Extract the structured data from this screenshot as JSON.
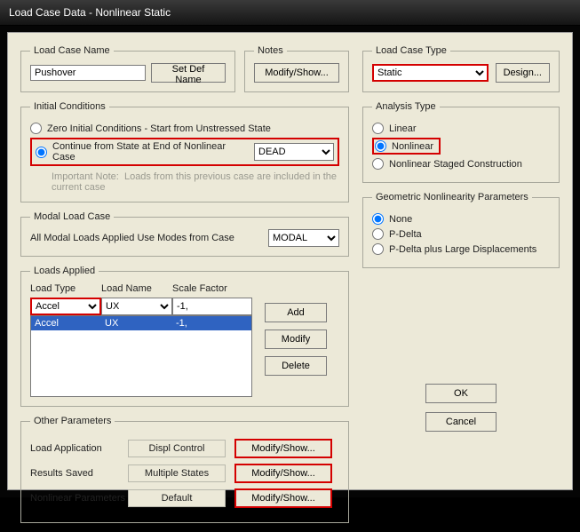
{
  "window": {
    "title": "Load Case Data - Nonlinear Static"
  },
  "loadCaseName": {
    "legend": "Load Case Name",
    "value": "Pushover",
    "setDefNameBtn": "Set Def Name"
  },
  "notes": {
    "legend": "Notes",
    "modifyShowBtn": "Modify/Show..."
  },
  "loadCaseType": {
    "legend": "Load Case Type",
    "selected": "Static",
    "designBtn": "Design..."
  },
  "initialConditions": {
    "legend": "Initial Conditions",
    "zeroLabel": "Zero Initial Conditions - Start from Unstressed State",
    "continueLabel": "Continue from State at End of Nonlinear Case",
    "continueCase": "DEAD",
    "noteLabel": "Important Note:",
    "noteText": "Loads from this previous case are included in the current case"
  },
  "analysisType": {
    "legend": "Analysis Type",
    "linearLabel": "Linear",
    "nonlinearLabel": "Nonlinear",
    "stagedLabel": "Nonlinear Staged Construction"
  },
  "modalLoadCase": {
    "legend": "Modal Load Case",
    "label": "All Modal Loads Applied Use Modes from Case",
    "selected": "MODAL"
  },
  "geometricNonlinearity": {
    "legend": "Geometric Nonlinearity Parameters",
    "noneLabel": "None",
    "pDeltaLabel": "P-Delta",
    "pDeltaLargeLabel": "P-Delta plus Large Displacements"
  },
  "loadsApplied": {
    "legend": "Loads Applied",
    "headers": {
      "type": "Load Type",
      "name": "Load Name",
      "scale": "Scale Factor"
    },
    "input": {
      "type": "Accel",
      "name": "UX",
      "scale": "-1,"
    },
    "rows": [
      {
        "type": "Accel",
        "name": "UX",
        "scale": "-1,"
      }
    ],
    "addBtn": "Add",
    "modifyBtn": "Modify",
    "deleteBtn": "Delete"
  },
  "otherParameters": {
    "legend": "Other Parameters",
    "loadApplicationLabel": "Load Application",
    "loadApplicationValue": "Displ Control",
    "resultsSavedLabel": "Results Saved",
    "resultsSavedValue": "Multiple States",
    "nonlinearParamsLabel": "Nonlinear Parameters",
    "nonlinearParamsValue": "Default",
    "modifyShowBtn": "Modify/Show..."
  },
  "dialog": {
    "okBtn": "OK",
    "cancelBtn": "Cancel"
  }
}
